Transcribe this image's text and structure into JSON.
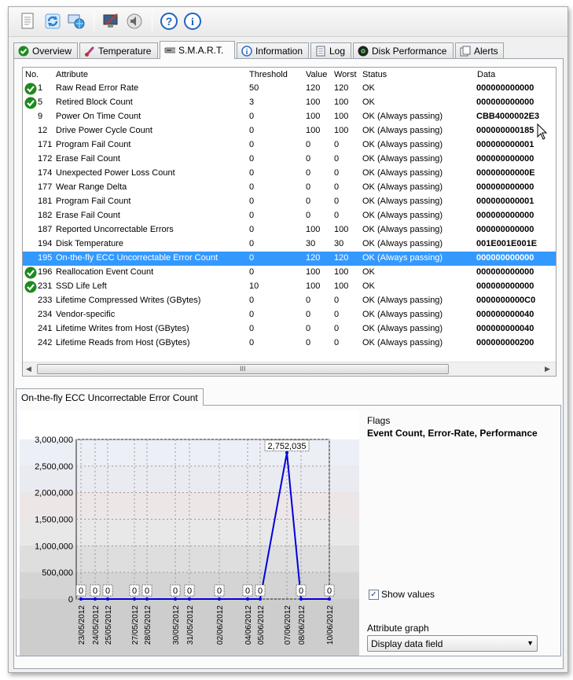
{
  "tabs": [
    {
      "label": "Overview",
      "icon": "green-check-icon"
    },
    {
      "label": "Temperature",
      "icon": "thermometer-icon"
    },
    {
      "label": "S.M.A.R.T.",
      "icon": "drive-icon"
    },
    {
      "label": "Information",
      "icon": "info-icon"
    },
    {
      "label": "Log",
      "icon": "log-document-icon"
    },
    {
      "label": "Disk Performance",
      "icon": "disk-performance-icon"
    },
    {
      "label": "Alerts",
      "icon": "alerts-document-icon"
    }
  ],
  "columns": [
    "No.",
    "Attribute",
    "Threshold",
    "Value",
    "Worst",
    "Status",
    "Data"
  ],
  "rows": [
    {
      "no": "1",
      "attribute": "Raw Read Error Rate",
      "threshold": "50",
      "value": "120",
      "worst": "120",
      "status": "OK",
      "data": "000000000000",
      "check": true
    },
    {
      "no": "5",
      "attribute": "Retired Block Count",
      "threshold": "3",
      "value": "100",
      "worst": "100",
      "status": "OK",
      "data": "000000000000",
      "check": true
    },
    {
      "no": "9",
      "attribute": "Power On Time Count",
      "threshold": "0",
      "value": "100",
      "worst": "100",
      "status": "OK (Always passing)",
      "data": "CBB4000002E3",
      "check": false
    },
    {
      "no": "12",
      "attribute": "Drive Power Cycle Count",
      "threshold": "0",
      "value": "100",
      "worst": "100",
      "status": "OK (Always passing)",
      "data": "000000000185",
      "check": false
    },
    {
      "no": "171",
      "attribute": "Program Fail Count",
      "threshold": "0",
      "value": "0",
      "worst": "0",
      "status": "OK (Always passing)",
      "data": "000000000001",
      "check": false
    },
    {
      "no": "172",
      "attribute": "Erase Fail Count",
      "threshold": "0",
      "value": "0",
      "worst": "0",
      "status": "OK (Always passing)",
      "data": "000000000000",
      "check": false
    },
    {
      "no": "174",
      "attribute": "Unexpected Power Loss Count",
      "threshold": "0",
      "value": "0",
      "worst": "0",
      "status": "OK (Always passing)",
      "data": "00000000000E",
      "check": false
    },
    {
      "no": "177",
      "attribute": "Wear Range Delta",
      "threshold": "0",
      "value": "0",
      "worst": "0",
      "status": "OK (Always passing)",
      "data": "000000000000",
      "check": false
    },
    {
      "no": "181",
      "attribute": "Program Fail Count",
      "threshold": "0",
      "value": "0",
      "worst": "0",
      "status": "OK (Always passing)",
      "data": "000000000001",
      "check": false
    },
    {
      "no": "182",
      "attribute": "Erase Fail Count",
      "threshold": "0",
      "value": "0",
      "worst": "0",
      "status": "OK (Always passing)",
      "data": "000000000000",
      "check": false
    },
    {
      "no": "187",
      "attribute": "Reported Uncorrectable Errors",
      "threshold": "0",
      "value": "100",
      "worst": "100",
      "status": "OK (Always passing)",
      "data": "000000000000",
      "check": false
    },
    {
      "no": "194",
      "attribute": "Disk Temperature",
      "threshold": "0",
      "value": "30",
      "worst": "30",
      "status": "OK (Always passing)",
      "data": "001E001E001E",
      "check": false
    },
    {
      "no": "195",
      "attribute": "On-the-fly ECC Uncorrectable Error Count",
      "threshold": "0",
      "value": "120",
      "worst": "120",
      "status": "OK (Always passing)",
      "data": "000000000000",
      "check": false,
      "selected": true
    },
    {
      "no": "196",
      "attribute": "Reallocation Event Count",
      "threshold": "0",
      "value": "100",
      "worst": "100",
      "status": "OK",
      "data": "000000000000",
      "check": true
    },
    {
      "no": "231",
      "attribute": "SSD Life Left",
      "threshold": "10",
      "value": "100",
      "worst": "100",
      "status": "OK",
      "data": "000000000000",
      "check": true
    },
    {
      "no": "233",
      "attribute": "Lifetime Compressed Writes (GBytes)",
      "threshold": "0",
      "value": "0",
      "worst": "0",
      "status": "OK (Always passing)",
      "data": "0000000000C0",
      "check": false
    },
    {
      "no": "234",
      "attribute": "Vendor-specific",
      "threshold": "0",
      "value": "0",
      "worst": "0",
      "status": "OK (Always passing)",
      "data": "000000000040",
      "check": false
    },
    {
      "no": "241",
      "attribute": "Lifetime Writes from Host (GBytes)",
      "threshold": "0",
      "value": "0",
      "worst": "0",
      "status": "OK (Always passing)",
      "data": "000000000040",
      "check": false
    },
    {
      "no": "242",
      "attribute": "Lifetime Reads from Host (GBytes)",
      "threshold": "0",
      "value": "0",
      "worst": "0",
      "status": "OK (Always passing)",
      "data": "000000000200",
      "check": false
    }
  ],
  "scrollbar_grip": "III",
  "graph_tab": "On-the-fly ECC Uncorrectable Error Count",
  "flags_label": "Flags",
  "flags_value": "Event Count, Error-Rate, Performance",
  "show_values_label": "Show values",
  "attribute_graph_label": "Attribute graph",
  "attribute_graph_value": "Display data field",
  "colors": {
    "selection": "#3399ff",
    "line": "#0000dd",
    "check": "#1d8a1d"
  },
  "chart_data": {
    "type": "line",
    "y_ticks": [
      "3,000,000",
      "2,500,000",
      "2,000,000",
      "1,500,000",
      "1,000,000",
      "500,000",
      "0"
    ],
    "ylim": [
      0,
      3000000
    ],
    "x_tick_labels": [
      "23/05/2012",
      "24/05/2012",
      "25/05/2012",
      "27/05/2012",
      "28/05/2012",
      "30/05/2012",
      "31/05/2012",
      "02/06/2012",
      "04/06/2012",
      "05/06/2012",
      "07/06/2012",
      "08/06/2012",
      "10/06/2012"
    ],
    "points": [
      {
        "x": "23/05/2012",
        "y": 0,
        "label": "0"
      },
      {
        "x": "24/05/2012",
        "y": 0,
        "label": "0"
      },
      {
        "x": "25/05/2012",
        "y": 0,
        "label": "0"
      },
      {
        "x": "27/05/2012",
        "y": 0,
        "label": "0"
      },
      {
        "x": "28/05/2012",
        "y": 0,
        "label": "0"
      },
      {
        "x": "30/05/2012",
        "y": 0,
        "label": "0"
      },
      {
        "x": "31/05/2012",
        "y": 0,
        "label": "0"
      },
      {
        "x": "02/06/2012",
        "y": 0,
        "label": "0"
      },
      {
        "x": "04/06/2012",
        "y": 0,
        "label": "0"
      },
      {
        "x": "05/06/2012",
        "y": 0,
        "label": "0"
      },
      {
        "x": "07/06/2012",
        "y": 2752035,
        "label": "2,752,035"
      },
      {
        "x": "08/06/2012",
        "y": 0,
        "label": "0"
      },
      {
        "x": "10/06/2012",
        "y": 0,
        "label": "0"
      }
    ]
  }
}
